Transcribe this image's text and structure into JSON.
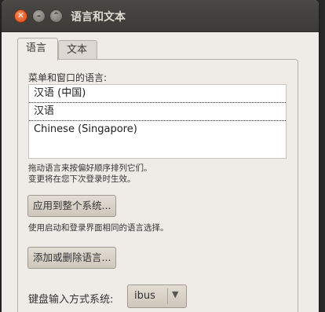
{
  "window": {
    "title": "语言和文本",
    "close_glyph": "✕",
    "min_glyph": "–",
    "max_glyph": "⌃"
  },
  "tabs": [
    {
      "label": "语言",
      "active": true
    },
    {
      "label": "文本",
      "active": false
    }
  ],
  "language_tab": {
    "menu_label": "菜单和窗口的语言:",
    "languages": [
      "汉语 (中国)",
      "汉语",
      "Chinese (Singapore)"
    ],
    "hint_line1": "拖动语言来按偏好顺序排列它们。",
    "hint_line2": "变更将在您下次登录时生效。",
    "apply_button": "应用到整个系统...",
    "apply_hint": "使用启动和登录界面相同的语言选择。",
    "add_remove_button": "添加或删除语言...",
    "keyboard_label": "键盘输入方式系统:",
    "input_method_value": "ibus",
    "dropdown_icon": "▼"
  },
  "colors": {
    "titlebar": "#3c3b37",
    "close_button": "#df4a18",
    "window_bg": "#efebe7"
  }
}
